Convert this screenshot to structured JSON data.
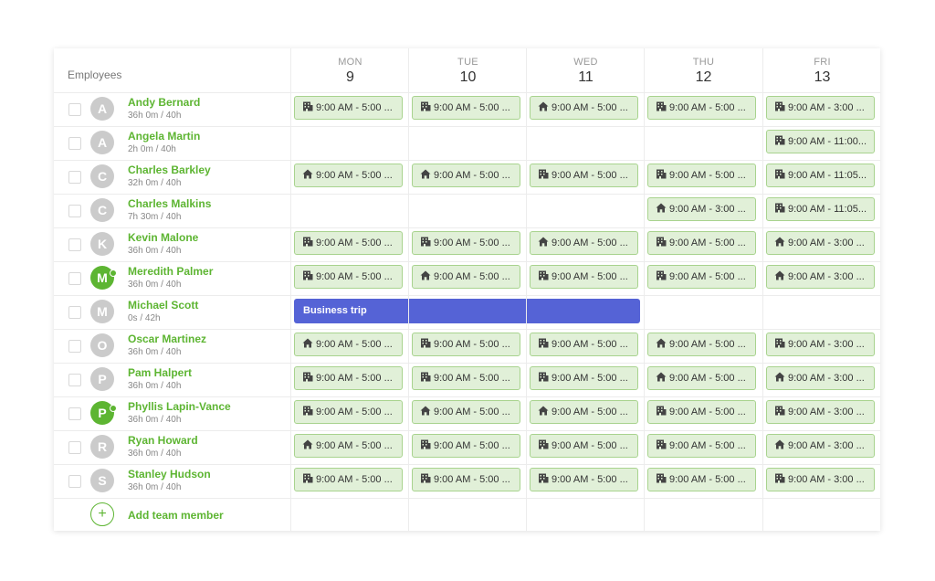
{
  "header": {
    "employees_label": "Employees",
    "days": [
      {
        "name": "MON",
        "date": "9"
      },
      {
        "name": "TUE",
        "date": "10"
      },
      {
        "name": "WED",
        "date": "11"
      },
      {
        "name": "THU",
        "date": "12"
      },
      {
        "name": "FRI",
        "date": "13"
      }
    ]
  },
  "employees": [
    {
      "initial": "A",
      "name": "Andy Bernard",
      "hours": "36h 0m / 40h",
      "online": false,
      "shifts": [
        {
          "icon": "building-icon",
          "text": "9:00 AM - 5:00 ..."
        },
        {
          "icon": "building-icon",
          "text": "9:00 AM - 5:00 ..."
        },
        {
          "icon": "home-icon",
          "text": "9:00 AM - 5:00 ..."
        },
        {
          "icon": "building-icon",
          "text": "9:00 AM - 5:00 ..."
        },
        {
          "icon": "building-icon",
          "text": "9:00 AM - 3:00 ..."
        }
      ]
    },
    {
      "initial": "A",
      "name": "Angela Martin",
      "hours": "2h 0m / 40h",
      "online": false,
      "shifts": [
        null,
        null,
        null,
        null,
        {
          "icon": "building-icon",
          "text": "9:00 AM - 11:00..."
        }
      ]
    },
    {
      "initial": "C",
      "name": "Charles Barkley",
      "hours": "32h 0m / 40h",
      "online": false,
      "shifts": [
        {
          "icon": "home-icon",
          "text": "9:00 AM - 5:00 ..."
        },
        {
          "icon": "home-icon",
          "text": "9:00 AM - 5:00 ..."
        },
        {
          "icon": "building-icon",
          "text": "9:00 AM - 5:00 ..."
        },
        {
          "icon": "building-icon",
          "text": "9:00 AM - 5:00 ..."
        },
        {
          "icon": "building-icon",
          "text": "9:00 AM - 11:05..."
        }
      ]
    },
    {
      "initial": "C",
      "name": "Charles Malkins",
      "hours": "7h 30m / 40h",
      "online": false,
      "shifts": [
        null,
        null,
        null,
        {
          "icon": "home-icon",
          "text": "9:00 AM - 3:00 ..."
        },
        {
          "icon": "building-icon",
          "text": "9:00 AM - 11:05..."
        }
      ]
    },
    {
      "initial": "K",
      "name": "Kevin Malone",
      "hours": "36h 0m / 40h",
      "online": false,
      "shifts": [
        {
          "icon": "building-icon",
          "text": "9:00 AM - 5:00 ..."
        },
        {
          "icon": "building-icon",
          "text": "9:00 AM - 5:00 ..."
        },
        {
          "icon": "home-icon",
          "text": "9:00 AM - 5:00 ..."
        },
        {
          "icon": "building-icon",
          "text": "9:00 AM - 5:00 ..."
        },
        {
          "icon": "home-icon",
          "text": "9:00 AM - 3:00 ..."
        }
      ]
    },
    {
      "initial": "M",
      "name": "Meredith Palmer",
      "hours": "36h 0m / 40h",
      "online": true,
      "shifts": [
        {
          "icon": "building-icon",
          "text": "9:00 AM - 5:00 ..."
        },
        {
          "icon": "home-icon",
          "text": "9:00 AM - 5:00 ..."
        },
        {
          "icon": "building-icon",
          "text": "9:00 AM - 5:00 ..."
        },
        {
          "icon": "building-icon",
          "text": "9:00 AM - 5:00 ..."
        },
        {
          "icon": "home-icon",
          "text": "9:00 AM - 3:00 ..."
        }
      ]
    },
    {
      "initial": "M",
      "name": "Michael Scott",
      "hours": "0s / 42h",
      "online": false,
      "trip": {
        "label": "Business trip",
        "days": 3
      },
      "shifts": [
        null,
        null,
        null,
        null,
        null
      ]
    },
    {
      "initial": "O",
      "name": "Oscar Martinez",
      "hours": "36h 0m / 40h",
      "online": false,
      "shifts": [
        {
          "icon": "home-icon",
          "text": "9:00 AM - 5:00 ..."
        },
        {
          "icon": "building-icon",
          "text": "9:00 AM - 5:00 ..."
        },
        {
          "icon": "building-icon",
          "text": "9:00 AM - 5:00 ..."
        },
        {
          "icon": "home-icon",
          "text": "9:00 AM - 5:00 ..."
        },
        {
          "icon": "building-icon",
          "text": "9:00 AM - 3:00 ..."
        }
      ]
    },
    {
      "initial": "P",
      "name": "Pam Halpert",
      "hours": "36h 0m / 40h",
      "online": false,
      "shifts": [
        {
          "icon": "building-icon",
          "text": "9:00 AM - 5:00 ..."
        },
        {
          "icon": "building-icon",
          "text": "9:00 AM - 5:00 ..."
        },
        {
          "icon": "building-icon",
          "text": "9:00 AM - 5:00 ..."
        },
        {
          "icon": "home-icon",
          "text": "9:00 AM - 5:00 ..."
        },
        {
          "icon": "home-icon",
          "text": "9:00 AM - 3:00 ..."
        }
      ]
    },
    {
      "initial": "P",
      "name": "Phyllis Lapin-Vance",
      "hours": "36h 0m / 40h",
      "online": true,
      "shifts": [
        {
          "icon": "building-icon",
          "text": "9:00 AM - 5:00 ..."
        },
        {
          "icon": "home-icon",
          "text": "9:00 AM - 5:00 ..."
        },
        {
          "icon": "home-icon",
          "text": "9:00 AM - 5:00 ..."
        },
        {
          "icon": "building-icon",
          "text": "9:00 AM - 5:00 ..."
        },
        {
          "icon": "building-icon",
          "text": "9:00 AM - 3:00 ..."
        }
      ]
    },
    {
      "initial": "R",
      "name": "Ryan Howard",
      "hours": "36h 0m / 40h",
      "online": false,
      "shifts": [
        {
          "icon": "home-icon",
          "text": "9:00 AM - 5:00 ..."
        },
        {
          "icon": "building-icon",
          "text": "9:00 AM - 5:00 ..."
        },
        {
          "icon": "building-icon",
          "text": "9:00 AM - 5:00 ..."
        },
        {
          "icon": "building-icon",
          "text": "9:00 AM - 5:00 ..."
        },
        {
          "icon": "home-icon",
          "text": "9:00 AM - 3:00 ..."
        }
      ]
    },
    {
      "initial": "S",
      "name": "Stanley Hudson",
      "hours": "36h 0m / 40h",
      "online": false,
      "shifts": [
        {
          "icon": "building-icon",
          "text": "9:00 AM - 5:00 ..."
        },
        {
          "icon": "building-icon",
          "text": "9:00 AM - 5:00 ..."
        },
        {
          "icon": "building-icon",
          "text": "9:00 AM - 5:00 ..."
        },
        {
          "icon": "building-icon",
          "text": "9:00 AM - 5:00 ..."
        },
        {
          "icon": "building-icon",
          "text": "9:00 AM - 3:00 ..."
        }
      ]
    }
  ],
  "add_member_label": "Add team member",
  "colors": {
    "accent": "#5db532",
    "shift_bg": "#e1f0d8",
    "shift_border": "#a8d38e",
    "trip": "#5563d6",
    "avatar": "#cbcbcb"
  }
}
